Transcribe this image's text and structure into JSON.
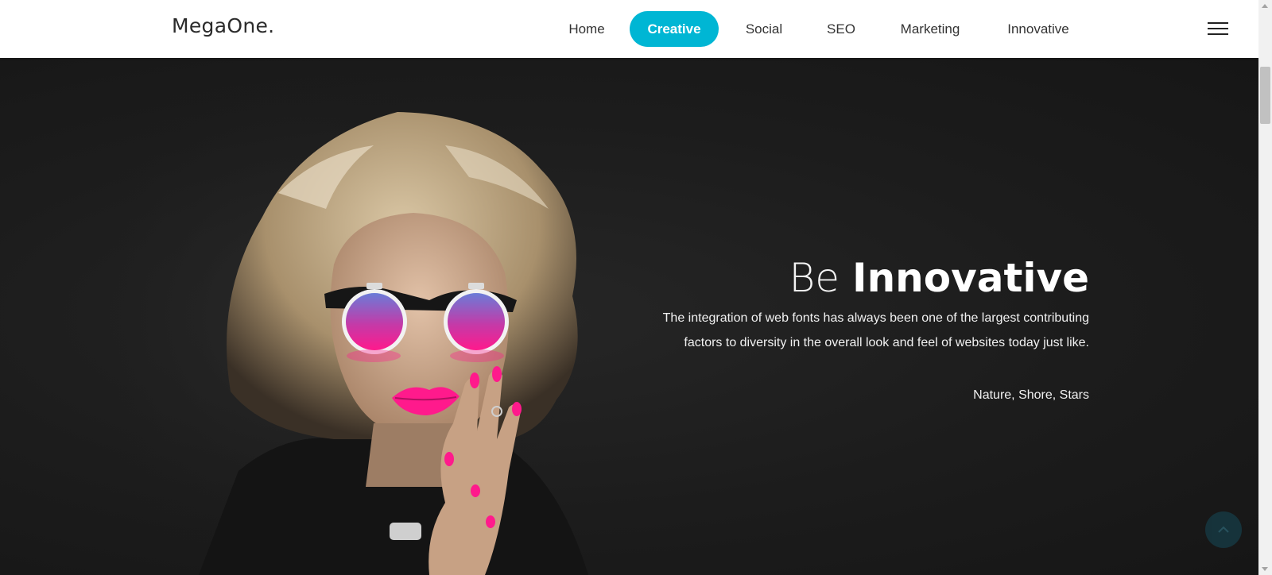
{
  "header": {
    "logo": "MegaOne.",
    "nav": [
      {
        "label": "Home"
      },
      {
        "label": "Creative",
        "active": true
      },
      {
        "label": "Social"
      },
      {
        "label": "SEO"
      },
      {
        "label": "Marketing"
      },
      {
        "label": "Innovative"
      }
    ]
  },
  "hero": {
    "title_light": "Be",
    "title_bold": "Innovative",
    "description": "The integration of web fonts has always been one of the largest contributing factors to diversity in the overall look and feel of websites today just like.",
    "tags": "Nature, Shore, Stars"
  },
  "colors": {
    "accent": "#00b6d4",
    "hero_background": "#1b1b1b",
    "lipstick": "#ff1a8c"
  },
  "icons": {
    "menu": "hamburger-menu-icon",
    "scroll_top": "chevron-up-icon"
  }
}
